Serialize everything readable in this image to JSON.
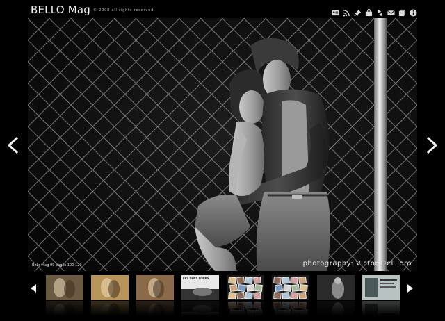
{
  "header": {
    "brand": "BELLO Mag",
    "copyright": "© 2008 all rights reserved"
  },
  "toolbar": {
    "icons": [
      "contact-card-icon",
      "rss-icon",
      "pin-icon",
      "shop-bag-icon",
      "share-icon",
      "mail-icon",
      "pages-icon",
      "info-icon"
    ]
  },
  "photo": {
    "caption_left": "Bello Mag 09 pages 100-120",
    "caption_right": "photography: Victor Del Toro"
  },
  "nav": {
    "prev_glyph": "<",
    "next_glyph": ">"
  },
  "thumbnails": [
    {
      "label": "",
      "tone": "#6b5a42"
    },
    {
      "label": "",
      "tone": "#b8955a"
    },
    {
      "label": "",
      "tone": "#8a6a48"
    },
    {
      "label": "LES SENS LOCKS",
      "tone": "#9a9a9a"
    },
    {
      "label": "",
      "tone": "#7a8a9a"
    },
    {
      "label": "",
      "tone": "#8a8270"
    },
    {
      "label": "",
      "tone": "#5a5a5a"
    },
    {
      "label": "",
      "tone": "#7b8a86"
    }
  ],
  "colors": {
    "background": "#000000",
    "text": "#e6e6e6"
  }
}
